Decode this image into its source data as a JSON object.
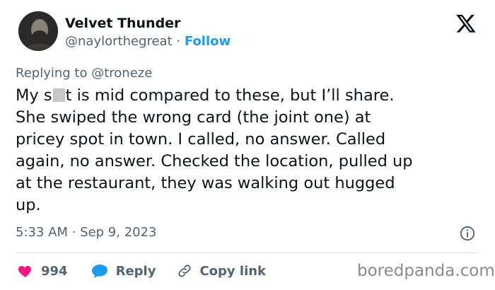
{
  "author": {
    "name": "Velvet Thunder",
    "handle": "@naylorthegreat",
    "separator": "·",
    "follow_label": "Follow"
  },
  "reply_context": {
    "prefix": "Replying to",
    "mention": "@troneze"
  },
  "tweet": {
    "censored_word_start": "My s",
    "text_after_censor": "t is mid compared to these, but I’ll share.\nShe swiped the wrong card (the joint one) at\npricey spot in town. I called, no answer. Called\nagain, no answer. Checked the location, pulled up\nat the restaurant, they was walking out hugged\nup."
  },
  "meta": {
    "timestamp": "5:33 AM · Sep 9, 2023"
  },
  "actions": {
    "like_count": "994",
    "reply_label": "Reply",
    "copy_label": "Copy link"
  },
  "watermark": "boredpanda.com",
  "icons": {
    "platform": "x-logo-icon",
    "like": "heart-icon",
    "reply": "speech-bubble-icon",
    "copy": "link-icon",
    "info": "info-icon"
  },
  "colors": {
    "accent": "#1d9bf0",
    "like": "#f91880",
    "muted": "#536471",
    "text": "#0f1419"
  }
}
